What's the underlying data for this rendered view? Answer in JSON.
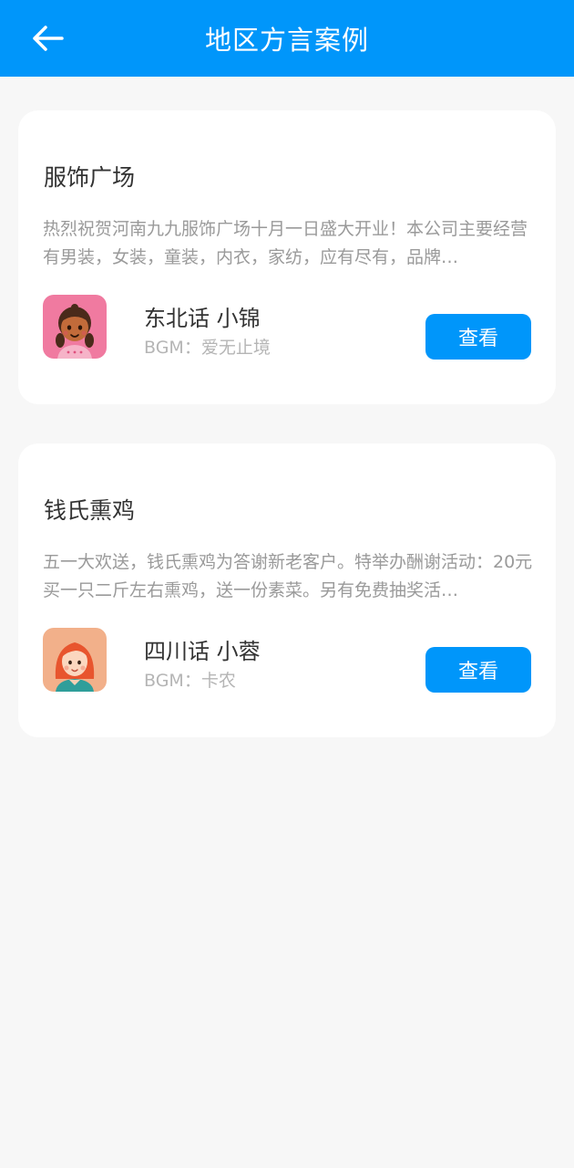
{
  "header": {
    "title": "地区方言案例",
    "back_icon": "arrow-left-icon"
  },
  "colors": {
    "accent": "#0096fa",
    "background": "#f7f7f7",
    "card": "#ffffff"
  },
  "cases": [
    {
      "title": "服饰广场",
      "description": "热烈祝贺河南九九服饰广场十月一日盛大开业！本公司主要经营有男装，女装，童装，内衣，家纺，应有尽有，品牌…",
      "voice": "东北话 小锦",
      "bgm": "BGM：爱无止境",
      "button": "查看",
      "avatar_icon": "girl-braids-avatar-icon",
      "avatar_bg": "#f07aa0"
    },
    {
      "title": "钱氏熏鸡",
      "description": "五一大欢送，钱氏熏鸡为答谢新老客户。特举办酬谢活动：20元买一只二斤左右熏鸡，送一份素菜。另有免费抽奖活…",
      "voice": "四川话 小蓉",
      "bgm": "BGM：卡农",
      "button": "查看",
      "avatar_icon": "girl-redhair-avatar-icon",
      "avatar_bg": "#f2b08a"
    }
  ]
}
